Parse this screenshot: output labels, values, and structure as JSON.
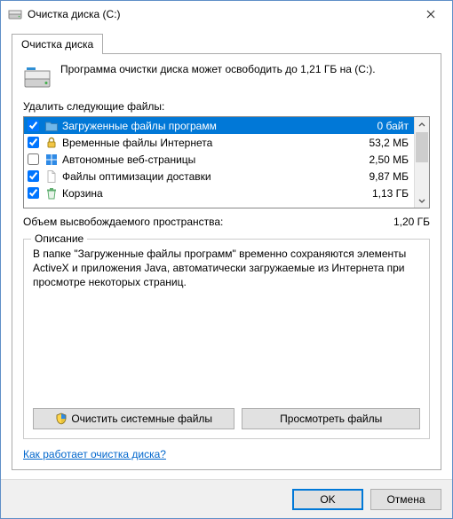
{
  "window": {
    "title": "Очистка диска  (C:)"
  },
  "tab": {
    "label": "Очистка диска"
  },
  "info": {
    "text": "Программа очистки диска может освободить до 1,21 ГБ на (C:)."
  },
  "delete_label": "Удалить следующие файлы:",
  "items": [
    {
      "checked": true,
      "name": "Загруженные файлы программ",
      "size": "0 байт",
      "icon": "folder",
      "selected": true
    },
    {
      "checked": true,
      "name": "Временные файлы Интернета",
      "size": "53,2 МБ",
      "icon": "lock",
      "selected": false
    },
    {
      "checked": false,
      "name": "Автономные веб-страницы",
      "size": "2,50 МБ",
      "icon": "win",
      "selected": false
    },
    {
      "checked": true,
      "name": "Файлы оптимизации доставки",
      "size": "9,87 МБ",
      "icon": "file",
      "selected": false
    },
    {
      "checked": true,
      "name": "Корзина",
      "size": "1,13 ГБ",
      "icon": "recycle",
      "selected": false
    }
  ],
  "total": {
    "label": "Объем высвобождаемого пространства:",
    "value": "1,20 ГБ"
  },
  "description": {
    "legend": "Описание",
    "text": "В папке \"Загруженные файлы программ\" временно сохраняются элементы ActiveX и приложения Java, автоматически загружаемые из Интернета при просмотре некоторых страниц."
  },
  "buttons": {
    "clean_system": "Очистить системные файлы",
    "view_files": "Просмотреть файлы",
    "ok": "OK",
    "cancel": "Отмена"
  },
  "link": {
    "text": "Как работает очистка диска?"
  }
}
